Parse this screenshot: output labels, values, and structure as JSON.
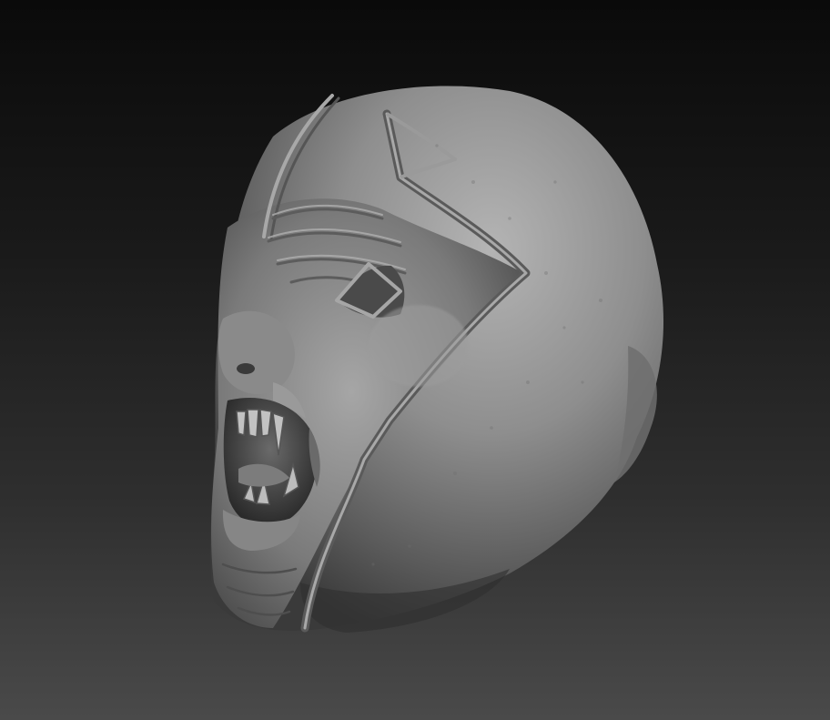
{
  "viewport": {
    "background_top": "#0a0a0a",
    "background_bottom": "#4a4a4a"
  },
  "sculpt": {
    "subject": "sculpted-monster-head",
    "material_color": "#8a8a8a",
    "highlight_color": "#b4b4b4",
    "shadow_color": "#3a3a3a"
  }
}
